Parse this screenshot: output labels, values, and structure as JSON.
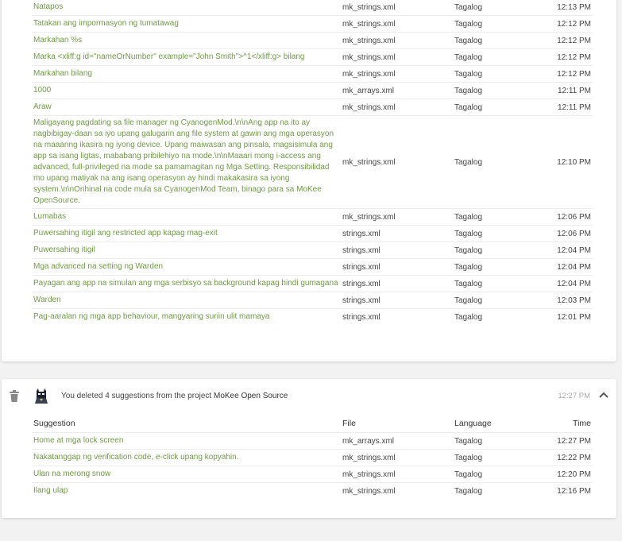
{
  "top_table": {
    "rows": [
      {
        "suggestion": "Natapos",
        "file": "mk_strings.xml",
        "language": "Tagalog",
        "time": "12:13 PM"
      },
      {
        "suggestion": "Tatakan ang impormasyon ng tumatawag",
        "file": "mk_strings.xml",
        "language": "Tagalog",
        "time": "12:12 PM"
      },
      {
        "suggestion": "Markahan %s",
        "file": "mk_strings.xml",
        "language": "Tagalog",
        "time": "12:12 PM"
      },
      {
        "suggestion": "Marka <xliff:g id=\"nameOrNumber\" example=\"John Smith\">^1</xliff:g> bilang",
        "file": "mk_strings.xml",
        "language": "Tagalog",
        "time": "12:12 PM"
      },
      {
        "suggestion": "Markahan bilang",
        "file": "mk_strings.xml",
        "language": "Tagalog",
        "time": "12:12 PM"
      },
      {
        "suggestion": "1000",
        "file": "mk_arrays.xml",
        "language": "Tagalog",
        "time": "12:11 PM"
      },
      {
        "suggestion": "Araw",
        "file": "mk_strings.xml",
        "language": "Tagalog",
        "time": "12:11 PM"
      },
      {
        "suggestion": "Maligayang pagdating sa file manager ng CyanogenMod.\\n\\nAng app na ito ay nagbibigay-daan sa iyo upang galugarin ang file system at gawin ang mga operasyon na maaaring ikasira ng iyong device. Upang maiwasan ang pinsala, magsisimula ang app sa isang ligtas, mababang pribilehiyo na mode.\\n\\nMaaari mong i-access ang advanced, full-privileged na mode sa pamamagitan ng Mga Setting. Responsibilidad mo upang matiyak na ang isang operasyon ay hindi makakasira sa iyong system.\\n\\nOrihinal na code mula sa CyanogenMod Team, binago para sa MoKee OpenSource.",
        "file": "mk_strings.xml",
        "language": "Tagalog",
        "time": "12:10 PM"
      },
      {
        "suggestion": "Lumabas",
        "file": "mk_strings.xml",
        "language": "Tagalog",
        "time": "12:06 PM"
      },
      {
        "suggestion": "Puwersahing itigil ang restricted app kapag mag-exit",
        "file": "strings.xml",
        "language": "Tagalog",
        "time": "12:06 PM"
      },
      {
        "suggestion": "Puwersahing itigil",
        "file": "strings.xml",
        "language": "Tagalog",
        "time": "12:04 PM"
      },
      {
        "suggestion": "Mga advanced na setting ng Warden",
        "file": "strings.xml",
        "language": "Tagalog",
        "time": "12:04 PM"
      },
      {
        "suggestion": "Payagan ang app na simulan ang mga serbisyo sa background kapag hindi gumagana",
        "file": "strings.xml",
        "language": "Tagalog",
        "time": "12:04 PM"
      },
      {
        "suggestion": "Warden",
        "file": "strings.xml",
        "language": "Tagalog",
        "time": "12:03 PM"
      },
      {
        "suggestion": "Pag-aaralan ng mga app behaviour, mangyaring suriin ulit mamaya",
        "file": "strings.xml",
        "language": "Tagalog",
        "time": "12:01 PM"
      }
    ]
  },
  "activity": {
    "icon": "trash-icon",
    "avatar": "batman-avatar",
    "text": "You deleted 4 suggestions from the project",
    "project": "MoKee Open Source",
    "time": "12:27 PM",
    "collapse_icon": "chevron-up-icon",
    "table": {
      "headers": {
        "suggestion": "Suggestion",
        "file": "File",
        "language": "Language",
        "time": "Time"
      },
      "rows": [
        {
          "suggestion": "Home at mga lock screen",
          "file": "mk_arrays.xml",
          "language": "Tagalog",
          "time": "12:27 PM"
        },
        {
          "suggestion": "Nakatanggap ng verification code, e-click upang kopyahin.",
          "file": "mk_strings.xml",
          "language": "Tagalog",
          "time": "12:22 PM"
        },
        {
          "suggestion": "Ulan na merong snow",
          "file": "mk_strings.xml",
          "language": "Tagalog",
          "time": "12:20 PM"
        },
        {
          "suggestion": "Ilang ulap",
          "file": "mk_strings.xml",
          "language": "Tagalog",
          "time": "12:16 PM"
        }
      ]
    }
  },
  "colors": {
    "link": "#6f9a45",
    "background": "#f2f2f2",
    "card": "#ffffff"
  }
}
